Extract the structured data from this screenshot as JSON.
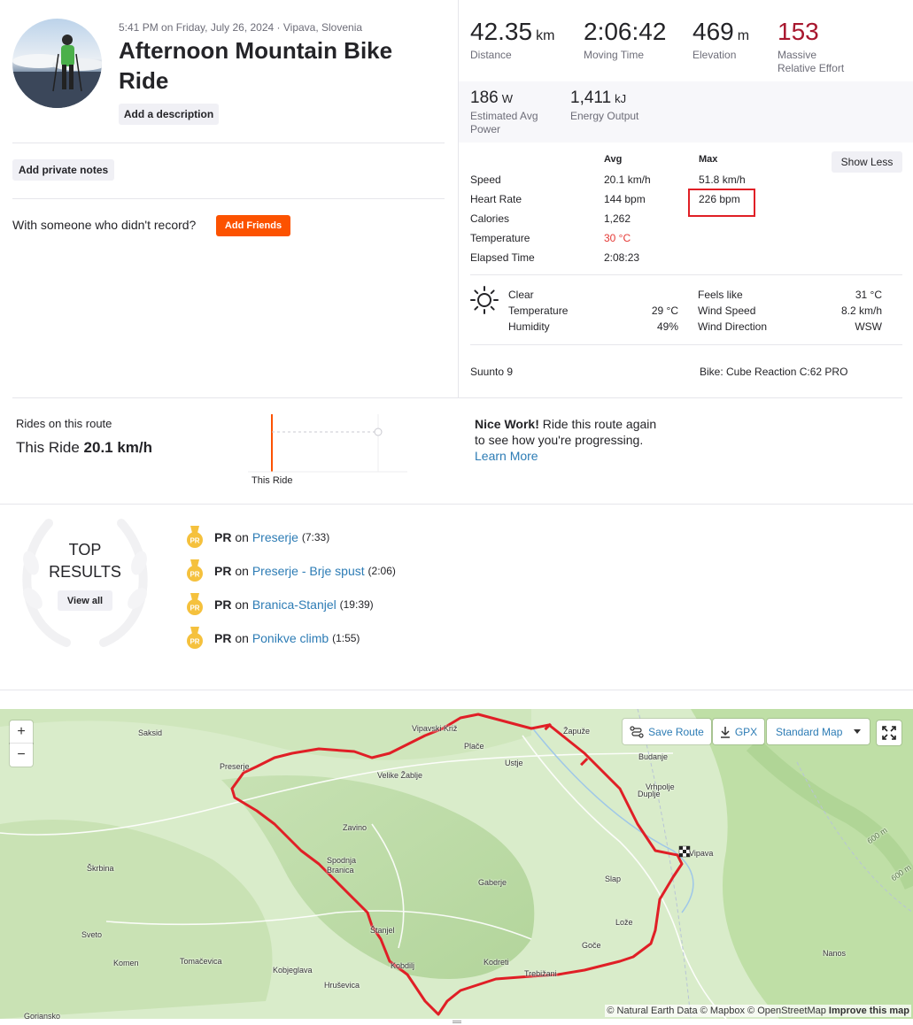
{
  "header": {
    "date_location": "5:41 PM on Friday, July 26, 2024 · Vipava, Slovenia",
    "title_line1": "Afternoon Mountain Bike",
    "title_line2": "Ride",
    "add_description": "Add a description",
    "add_private_notes": "Add private notes",
    "with_someone": "With someone who didn't record?",
    "add_friends": "Add Friends"
  },
  "stats": {
    "distance": {
      "value": "42.35",
      "unit": "km",
      "label": "Distance"
    },
    "moving_time": {
      "value": "2:06:42",
      "label": "Moving Time"
    },
    "elevation": {
      "value": "469",
      "unit": "m",
      "label": "Elevation"
    },
    "effort": {
      "value": "153",
      "label_line1": "Massive",
      "label_line2": "Relative Effort"
    },
    "power": {
      "value": "186",
      "unit": "W",
      "label_line1": "Estimated Avg",
      "label_line2": "Power"
    },
    "energy": {
      "value": "1,411",
      "unit": "kJ",
      "label": "Energy Output"
    }
  },
  "details": {
    "col_avg": "Avg",
    "col_max": "Max",
    "show_less": "Show Less",
    "rows": [
      {
        "label": "Speed",
        "avg": "20.1 km/h",
        "max": "51.8 km/h"
      },
      {
        "label": "Heart Rate",
        "avg": "144 bpm",
        "max": "226 bpm"
      },
      {
        "label": "Calories",
        "avg": "1,262",
        "max": ""
      },
      {
        "label": "Temperature",
        "avg": "30 °C",
        "max": ""
      },
      {
        "label": "Elapsed Time",
        "avg": "2:08:23",
        "max": ""
      }
    ]
  },
  "weather": {
    "condition": "Clear",
    "temperature_label": "Temperature",
    "temperature": "29 °C",
    "humidity_label": "Humidity",
    "humidity": "49%",
    "feels_like_label": "Feels like",
    "feels_like": "31 °C",
    "wind_speed_label": "Wind Speed",
    "wind_speed": "8.2 km/h",
    "wind_dir_label": "Wind Direction",
    "wind_dir": "WSW"
  },
  "device": "Suunto 9",
  "bike": "Bike: Cube Reaction C:62 PRO",
  "route_compare": {
    "heading": "Rides on this route",
    "this_ride_prefix": "This Ride",
    "this_ride_speed": "20.1 km/h",
    "axis_label": "This Ride",
    "nice_work": "Nice Work!",
    "message_line1": " Ride this route again",
    "message_line2": "to see how you're progressing.",
    "learn_more": "Learn More"
  },
  "top_results": {
    "title_line1": "TOP",
    "title_line2": "RESULTS",
    "view_all": "View all",
    "items": [
      {
        "badge": "PR",
        "on": "on",
        "segment": "Preserje",
        "time": "(7:33)"
      },
      {
        "badge": "PR",
        "on": "on",
        "segment": "Preserje - Brje spust",
        "time": "(2:06)"
      },
      {
        "badge": "PR",
        "on": "on",
        "segment": "Branica-Stanjel",
        "time": "(19:39)"
      },
      {
        "badge": "PR",
        "on": "on",
        "segment": "Ponikve climb",
        "time": "(1:55)"
      }
    ]
  },
  "map": {
    "zoom_in": "+",
    "zoom_out": "−",
    "save_route": "Save Route",
    "gpx": "GPX",
    "map_style": "Standard Map",
    "attribution_1": "© Natural Earth Data",
    "attribution_2": "© Mapbox",
    "attribution_3": "© OpenStreetMap",
    "attribution_improve": "Improve this map",
    "places": [
      "Saksid",
      "Vipavski Križ",
      "Žapuže",
      "Budanje",
      "Plače",
      "Ustje",
      "Preserje",
      "Velike Žablje",
      "Vrhpolje",
      "Duplje",
      "Zavino",
      "Spodnja Branica",
      "Škrbina",
      "Gaberje",
      "Slap",
      "Lože",
      "Sveto",
      "Komen",
      "Tomačevica",
      "Kobjeglava",
      "Štanjel",
      "Kodreti",
      "Goče",
      "Trebižani",
      "Hruševica",
      "Kobdilj",
      "Nanos",
      "Gorjansko",
      "Vipava",
      "600 m",
      "600 m"
    ],
    "route_color": "#e01f26"
  },
  "colors": {
    "brand_orange": "#fc5200",
    "effort_red": "#a8172e",
    "link_blue": "#2d7cb5",
    "highlight_box": "#e01f26",
    "temp_red": "#e53935"
  }
}
